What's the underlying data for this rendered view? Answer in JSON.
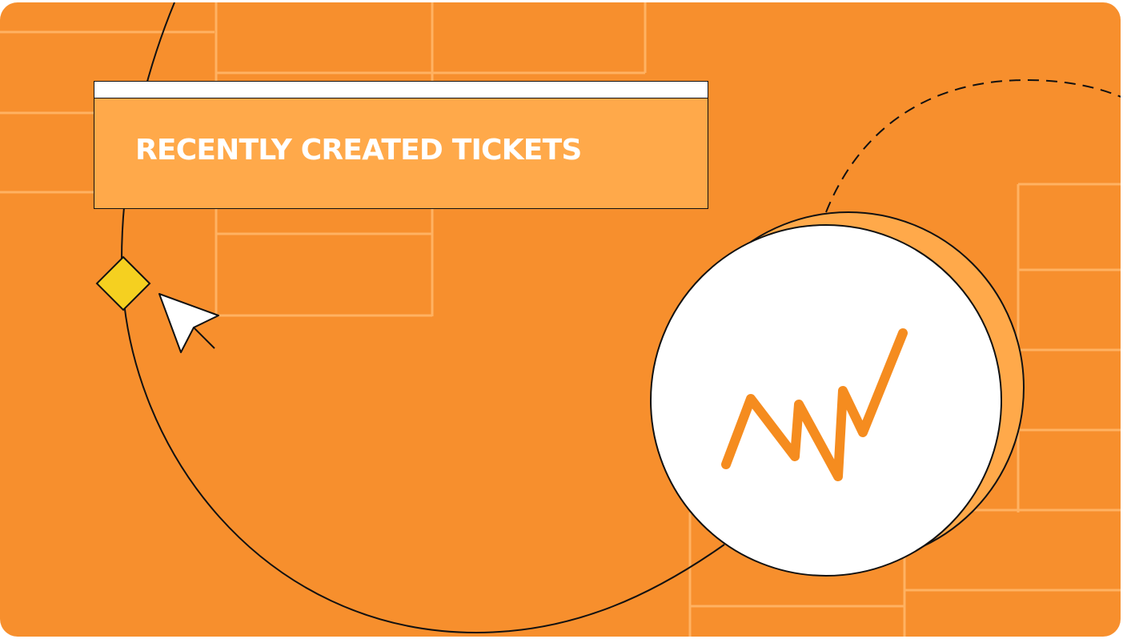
{
  "colors": {
    "background": "#f78f2d",
    "card": "#ffa94a",
    "grid_lines": "#ffb262",
    "accent_line": "#f58c1f",
    "diamond": "#f5d020",
    "outline": "#111111",
    "white": "#ffffff"
  },
  "card": {
    "title": "RECENTLY CREATED TICKETS"
  },
  "icons": {
    "diamond": "diamond-marker-icon",
    "cursor": "mouse-cursor-icon",
    "activity": "activity-zigzag-icon"
  }
}
